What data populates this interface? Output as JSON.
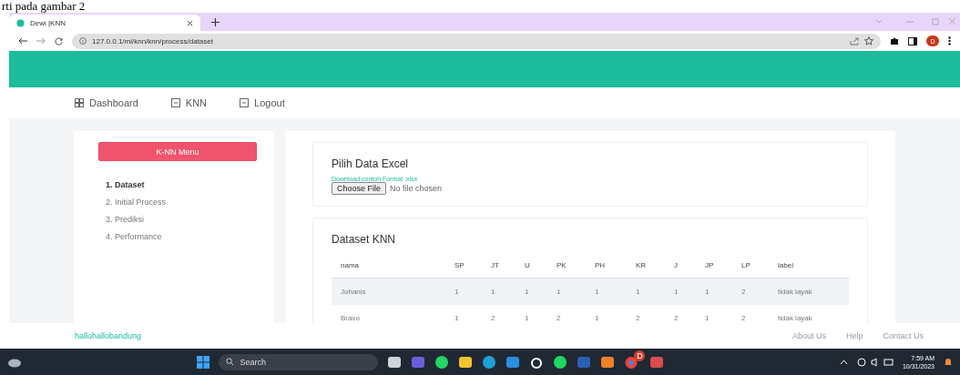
{
  "document_caption": "rti pada gambar 2",
  "browser": {
    "tab_title": "Dewi |KNN",
    "url": "127.0.0.1/ml/knn/knn/process/dataset",
    "profile_initial": "D"
  },
  "nav": [
    {
      "label": "Dashboard",
      "kind": "grid"
    },
    {
      "label": "KNN",
      "kind": "tray"
    },
    {
      "label": "Logout",
      "kind": "tray"
    }
  ],
  "sidebar": {
    "menu_button": "K-NN Menu",
    "items": [
      {
        "label": "1. Dataset",
        "selected": true
      },
      {
        "label": "2. Initial Process",
        "selected": false
      },
      {
        "label": "3. Prediksi",
        "selected": false
      },
      {
        "label": "4. Performance",
        "selected": false
      }
    ]
  },
  "upload_card": {
    "title": "Pilih Data Excel",
    "download_link": "Download contoh Format .xlsx",
    "file_button": "Choose File",
    "file_status": "No file chosen"
  },
  "dataset_card": {
    "title": "Dataset KNN",
    "columns": [
      "nama",
      "SP",
      "JT",
      "U",
      "PK",
      "PH",
      "KR",
      "J",
      "JP",
      "LP",
      "label"
    ],
    "rows": [
      [
        "Johanis",
        "1",
        "1",
        "1",
        "1",
        "1",
        "1",
        "1",
        "1",
        "2",
        "tidak layak"
      ],
      [
        "Bravo",
        "1",
        "2",
        "1",
        "2",
        "1",
        "2",
        "2",
        "1",
        "2",
        "tidak layak"
      ]
    ]
  },
  "footer": {
    "brand": "hallohallobandung",
    "links": [
      "About Us",
      "Help",
      "Contact Us"
    ]
  },
  "taskbar": {
    "search": "Search",
    "time": "7:59 AM",
    "date": "10/31/2023",
    "badge": "D"
  }
}
